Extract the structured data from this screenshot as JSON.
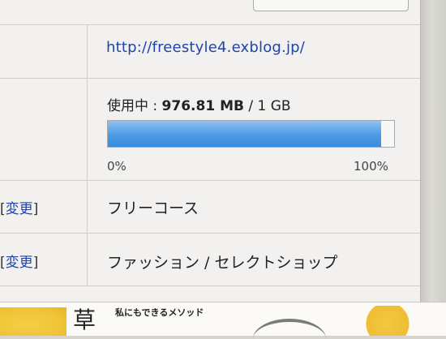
{
  "blog": {
    "url": "http://freestyle4.exblog.jp/"
  },
  "storage": {
    "label": "使用中 : ",
    "used": "976.81 MB",
    "separator": " / ",
    "total": "1 GB",
    "progress_fraction": 0.954,
    "min_label": "0%",
    "max_label": "100%",
    "colors": {
      "fill": "#4c9be6",
      "track": "#f7f7f7"
    }
  },
  "rows": [
    {
      "change_open": "[",
      "change_label": "変更",
      "change_close": "]",
      "value": "フリーコース"
    },
    {
      "change_open": "[",
      "change_label": "変更",
      "change_close": "]",
      "value": "ファッション / セレクトショップ"
    }
  ],
  "banner": {
    "glyph": "草",
    "text": "私にもできるメソッド"
  }
}
